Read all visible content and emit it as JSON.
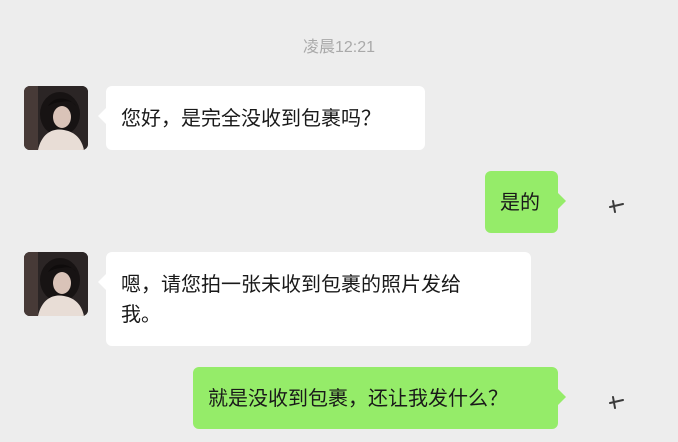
{
  "time": "凌晨12:21",
  "messages": [
    {
      "side": "left",
      "text": "您好，是完全没收到包裹吗？",
      "has_avatar": true
    },
    {
      "side": "right",
      "text": "是的"
    },
    {
      "side": "left",
      "text": "嗯，请您拍一张未收到包裹的照片发给我。",
      "line1": "嗯，请您拍一张未收到包裹的照片发给",
      "line2": "我。",
      "has_avatar": true
    },
    {
      "side": "right",
      "text": "就是没收到包裹，还让我发什么？"
    }
  ],
  "colors": {
    "background": "#ededed",
    "incoming_bubble": "#ffffff",
    "outgoing_bubble": "#95ec69",
    "timestamp": "#a9a9a9"
  },
  "icons": {
    "avatar": "girl-avatar-photo",
    "outgoing_mark": "small-handwritten-mark-icon"
  }
}
